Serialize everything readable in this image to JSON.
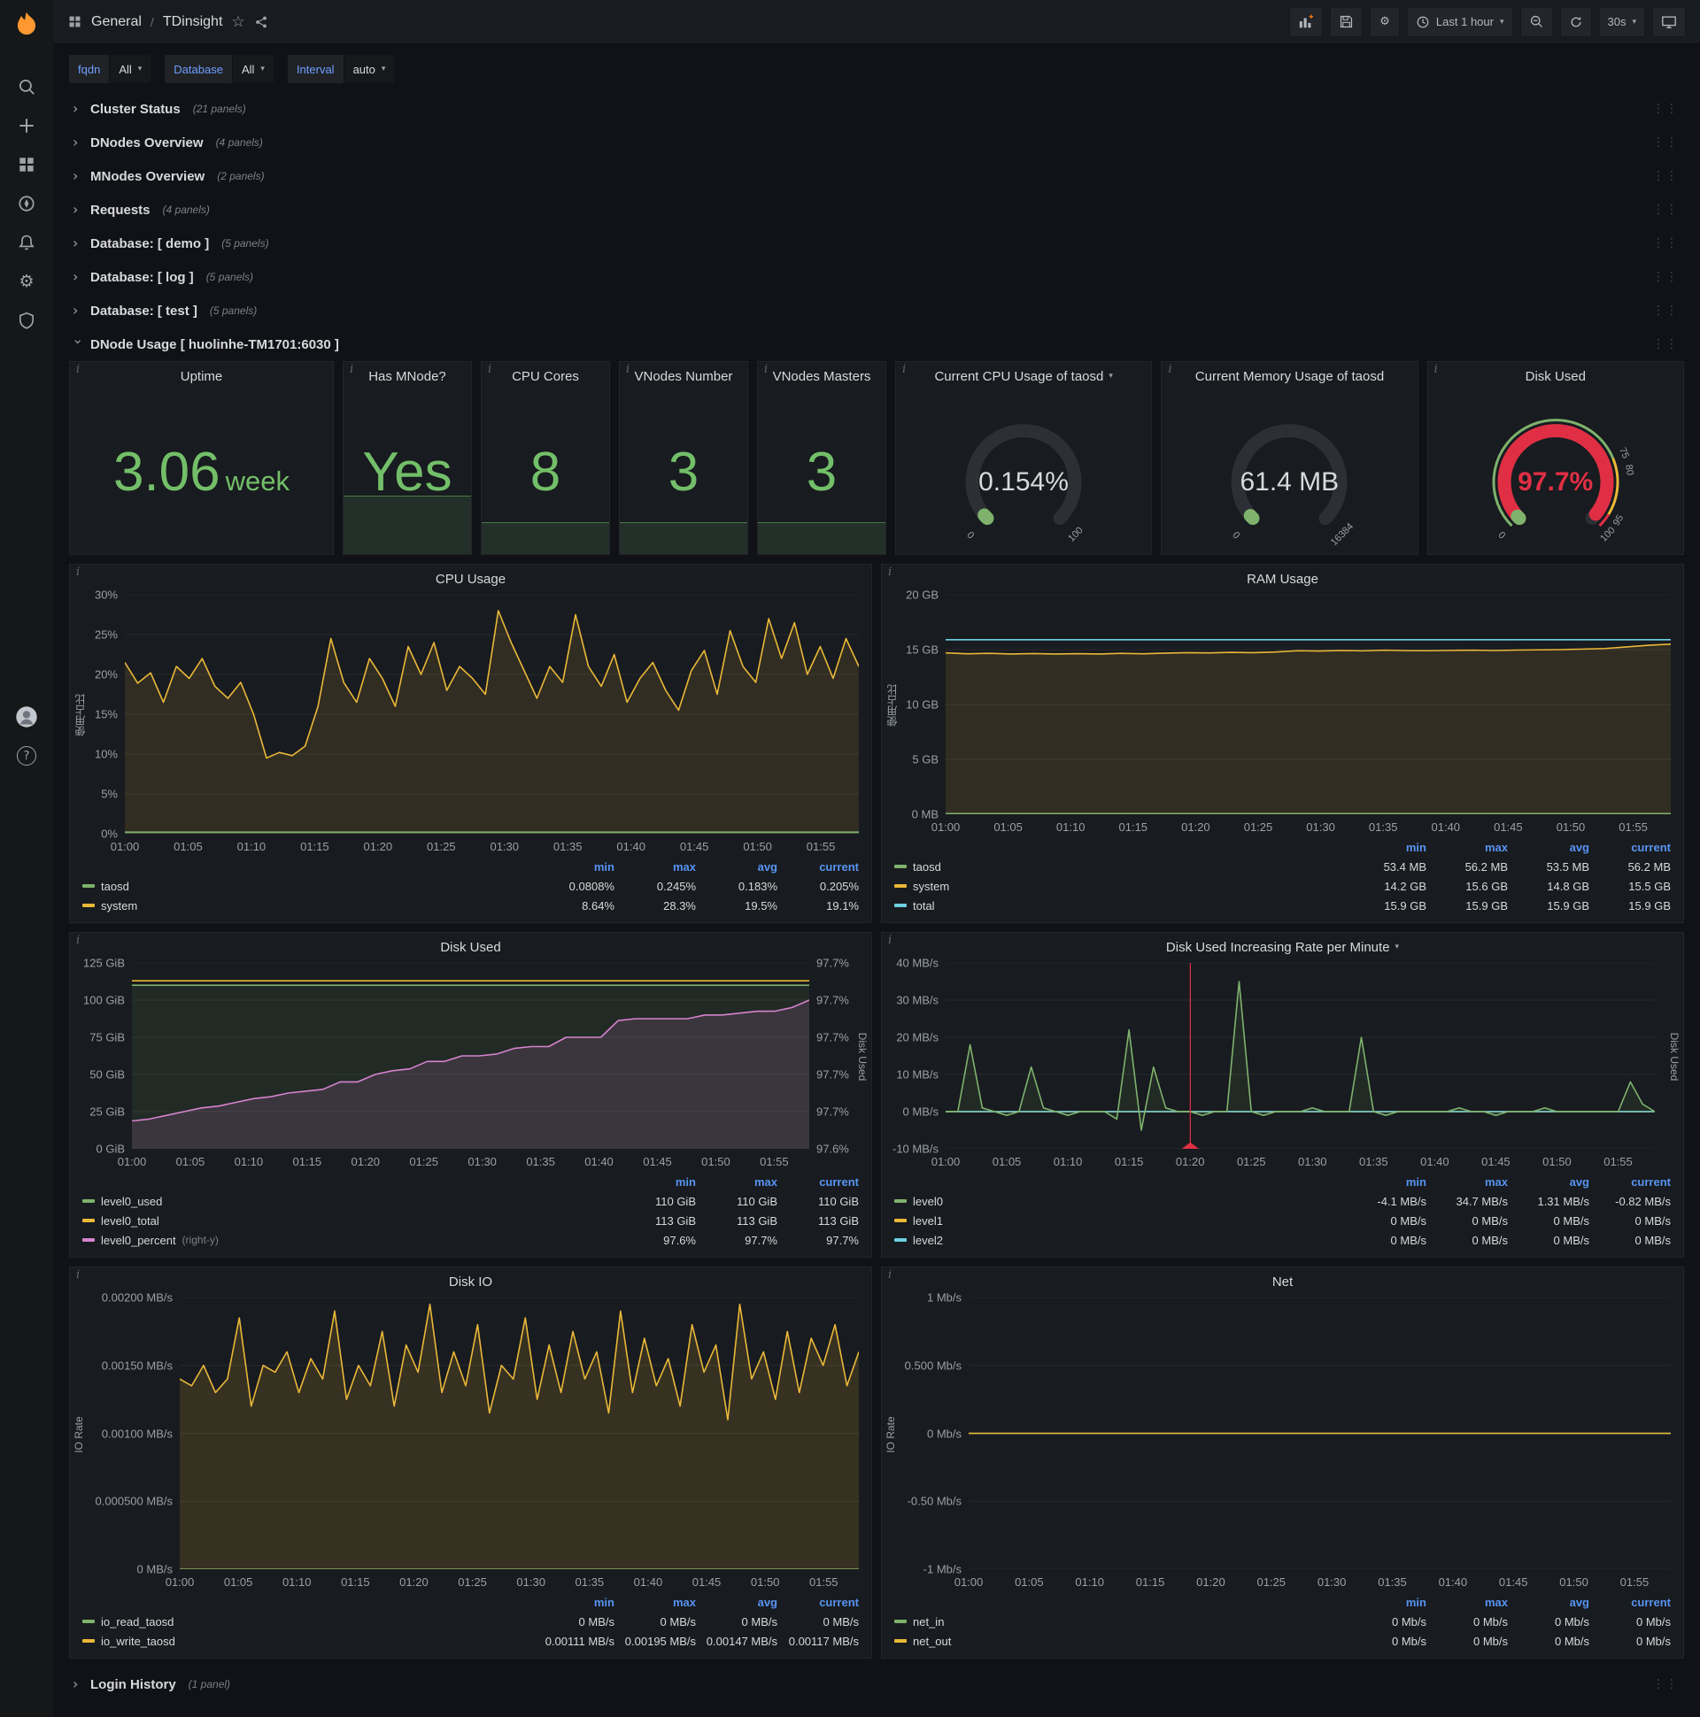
{
  "ui": {
    "info_glyph": "i",
    "caret": "▾",
    "chevron": "›",
    "drag_dots": "⋮⋮",
    "help_glyph": "?"
  },
  "topnav": {
    "breadcrumb": {
      "section": "General",
      "sep": "/",
      "page": "TDinsight"
    },
    "time_range": "Last 1 hour",
    "refresh": "30s"
  },
  "variables": [
    {
      "label": "fqdn",
      "value": "All"
    },
    {
      "label": "Database",
      "value": "All"
    },
    {
      "label": "Interval",
      "value": "auto"
    }
  ],
  "rows": [
    {
      "title": "Cluster Status",
      "count": "(21 panels)"
    },
    {
      "title": "DNodes Overview",
      "count": "(4 panels)"
    },
    {
      "title": "MNodes Overview",
      "count": "(2 panels)"
    },
    {
      "title": "Requests",
      "count": "(4 panels)"
    },
    {
      "title": "Database: [ demo ]",
      "count": "(5 panels)"
    },
    {
      "title": "Database: [ log ]",
      "count": "(5 panels)"
    },
    {
      "title": "Database: [ test ]",
      "count": "(5 panels)"
    }
  ],
  "expanded_row": {
    "title": "DNode Usage [ huolinhe-TM1701:6030 ]"
  },
  "bottom_row": {
    "title": "Login History",
    "count": "(1 panel)"
  },
  "stats": [
    {
      "title": "Uptime",
      "value": "3.06",
      "unit": "week"
    },
    {
      "title": "Has MNode?",
      "value": "Yes"
    },
    {
      "title": "CPU Cores",
      "value": "8"
    },
    {
      "title": "VNodes Number",
      "value": "3"
    },
    {
      "title": "VNodes Masters",
      "value": "3"
    }
  ],
  "gauges": [
    {
      "title": "Current CPU Usage of taosd",
      "has_dropdown": true,
      "value": "0.154%",
      "fraction": 0.018,
      "bar_color": "#7eb26d",
      "value_color": "#d8d9da",
      "ticks": [
        {
          "v": 0,
          "label": "0"
        },
        {
          "v": 100,
          "label": "100"
        }
      ]
    },
    {
      "title": "Current Memory Usage of taosd",
      "value": "61.4 MB",
      "fraction": 0.015,
      "bar_color": "#7eb26d",
      "value_color": "#d8d9da",
      "ticks": [
        {
          "v": 0,
          "label": "0"
        },
        {
          "v": 100,
          "label": "16384"
        }
      ]
    },
    {
      "title": "Disk Used",
      "value": "97.7%",
      "fraction": 0.977,
      "bar_color": "#e02f44",
      "value_color": "#e02f44",
      "start_cap": "#7eb26d",
      "ring": [
        {
          "to": 0.75,
          "color": "#7eb26d"
        },
        {
          "to": 0.95,
          "color": "#eab839"
        },
        {
          "to": 1,
          "color": "#e02f44"
        }
      ],
      "ticks": [
        {
          "v": 0,
          "label": "0"
        },
        {
          "v": 75,
          "label": "75"
        },
        {
          "v": 80,
          "label": "80"
        },
        {
          "v": 95,
          "label": "95"
        },
        {
          "v": 100,
          "label": "100"
        }
      ]
    }
  ],
  "time_axis": {
    "ticks": [
      "01:00",
      "01:05",
      "01:10",
      "01:15",
      "01:20",
      "01:25",
      "01:30",
      "01:35",
      "01:40",
      "01:45",
      "01:50",
      "01:55"
    ],
    "step_frac": 0.0862
  },
  "chart_data": [
    {
      "id": "cpu-usage",
      "type": "line",
      "title": "CPU Usage",
      "ylabel": "使用占比",
      "ylim": [
        0,
        30
      ],
      "ytick_w": 44,
      "yticks": [
        "30%",
        "25%",
        "20%",
        "15%",
        "10%",
        "5%",
        "0%"
      ],
      "series": [
        {
          "name": "system",
          "color": "#eab839",
          "fill": 0.12,
          "values": [
            21.5,
            18.9,
            20.2,
            16.5,
            21,
            19.5,
            22,
            18.5,
            17,
            19,
            15,
            9.5,
            10.2,
            9.8,
            11,
            16,
            24.5,
            19,
            16.5,
            22,
            19.5,
            16,
            23.5,
            20,
            24,
            18,
            21,
            19.5,
            17.5,
            28,
            24,
            20.5,
            17,
            21,
            19,
            27.5,
            21,
            18.5,
            22.5,
            16.5,
            19.5,
            21.5,
            18,
            15.5,
            20.5,
            23,
            17.5,
            25.5,
            21,
            19,
            27,
            22,
            26.5,
            20,
            23.5,
            19.5,
            24.5,
            21
          ]
        },
        {
          "name": "taosd",
          "color": "#7eb26d",
          "fill": 0.25,
          "value": 0.2
        }
      ],
      "legend": {
        "columns": [
          "min",
          "max",
          "avg",
          "current"
        ],
        "rows": [
          {
            "name": "taosd",
            "color": "#7eb26d",
            "values": [
              "0.0808%",
              "0.245%",
              "0.183%",
              "0.205%"
            ]
          },
          {
            "name": "system",
            "color": "#eab839",
            "values": [
              "8.64%",
              "28.3%",
              "19.5%",
              "19.1%"
            ]
          }
        ]
      }
    },
    {
      "id": "ram-usage",
      "type": "line",
      "title": "RAM Usage",
      "ylabel": "使用占比",
      "ylim": [
        0,
        20
      ],
      "ytick_w": 54,
      "yticks": [
        "20 GB",
        "15 GB",
        "10 GB",
        "5 GB",
        "0 MB"
      ],
      "series": [
        {
          "name": "system",
          "color": "#eab839",
          "fill": 0.12,
          "values": [
            14.7,
            14.62,
            14.66,
            14.6,
            14.64,
            14.6,
            14.63,
            14.6,
            14.66,
            14.62,
            14.68,
            14.72,
            14.7,
            14.75,
            14.72,
            14.78,
            14.9,
            14.87,
            14.92,
            14.89,
            14.95,
            14.91,
            14.9,
            14.93,
            14.95,
            14.92,
            14.96,
            14.98,
            15,
            15.05,
            15.1,
            15.25,
            15.4,
            15.5
          ]
        },
        {
          "name": "taosd",
          "color": "#7eb26d",
          "value": 0.055
        },
        {
          "name": "total",
          "color": "#6ed0e0",
          "value": 15.9
        }
      ],
      "legend": {
        "columns": [
          "min",
          "max",
          "avg",
          "current"
        ],
        "rows": [
          {
            "name": "taosd",
            "color": "#7eb26d",
            "values": [
              "53.4 MB",
              "56.2 MB",
              "53.5 MB",
              "56.2 MB"
            ]
          },
          {
            "name": "system",
            "color": "#eab839",
            "values": [
              "14.2 GB",
              "15.6 GB",
              "14.8 GB",
              "15.5 GB"
            ]
          },
          {
            "name": "total",
            "color": "#6ed0e0",
            "values": [
              "15.9 GB",
              "15.9 GB",
              "15.9 GB",
              "15.9 GB"
            ]
          }
        ]
      }
    },
    {
      "id": "disk-used",
      "type": "line",
      "title": "Disk Used",
      "ylim": [
        0,
        125
      ],
      "ytick_w": 64,
      "yticks": [
        "125 GiB",
        "100 GiB",
        "75 GiB",
        "50 GiB",
        "25 GiB",
        "0 GiB"
      ],
      "ylim_right": [
        97.64,
        97.74
      ],
      "ytick_right_w": 52,
      "yticks_right": [
        "97.7%",
        "97.7%",
        "97.7%",
        "97.7%",
        "97.7%",
        "97.6%"
      ],
      "ylabel_right": "Disk Used",
      "series": [
        {
          "name": "level0_used",
          "color": "#7eb26d",
          "fill": 0.1,
          "value": 110
        },
        {
          "name": "level0_percent",
          "color": "#d683ce",
          "axis": "right",
          "fill": 0.14,
          "values": [
            97.655,
            97.656,
            97.658,
            97.66,
            97.662,
            97.663,
            97.665,
            97.667,
            97.668,
            97.67,
            97.671,
            97.672,
            97.676,
            97.676,
            97.68,
            97.682,
            97.683,
            97.687,
            97.687,
            97.69,
            97.69,
            97.691,
            97.694,
            97.695,
            97.695,
            97.7,
            97.7,
            97.7,
            97.709,
            97.71,
            97.71,
            97.71,
            97.71,
            97.712,
            97.712,
            97.713,
            97.714,
            97.714,
            97.716,
            97.72
          ]
        },
        {
          "name": "level0_total",
          "color": "#eab839",
          "value": 113
        }
      ],
      "legend": {
        "columns": [
          "min",
          "max",
          "current"
        ],
        "rows": [
          {
            "name": "level0_used",
            "color": "#7eb26d",
            "values": [
              "110 GiB",
              "110 GiB",
              "110 GiB"
            ]
          },
          {
            "name": "level0_total",
            "color": "#eab839",
            "values": [
              "113 GiB",
              "113 GiB",
              "113 GiB"
            ]
          },
          {
            "name": "level0_percent",
            "suffix": "(right-y)",
            "color": "#d683ce",
            "values": [
              "97.6%",
              "97.7%",
              "97.7%"
            ]
          }
        ]
      }
    },
    {
      "id": "disk-rate",
      "type": "line",
      "title": "Disk Used Increasing Rate per Minute",
      "has_dropdown": true,
      "ylim": [
        -10,
        40
      ],
      "ytick_w": 66,
      "yticks": [
        "40 MB/s",
        "30 MB/s",
        "20 MB/s",
        "10 MB/s",
        "0 MB/s",
        "-10 MB/s"
      ],
      "ylabel_right": "Disk Used",
      "annotation_x": 0.345,
      "series": [
        {
          "name": "level1",
          "color": "#eab839",
          "value": 0
        },
        {
          "name": "level2",
          "color": "#6ed0e0",
          "value": 0
        },
        {
          "name": "level0",
          "color": "#7eb26d",
          "fill": 0.1,
          "values": [
            0,
            0,
            18,
            1,
            0,
            -1,
            0,
            12,
            1,
            0,
            -1,
            0,
            0,
            0,
            -2,
            22,
            -5,
            12,
            1,
            0,
            0,
            -1,
            0,
            0,
            35,
            0,
            -1,
            0,
            0,
            0,
            1,
            0,
            0,
            0,
            20,
            0,
            -1,
            0,
            0,
            0,
            0,
            0,
            1,
            0,
            0,
            -1,
            0,
            0,
            0,
            1,
            0,
            0,
            0,
            0,
            0,
            0,
            8,
            2,
            0
          ]
        }
      ],
      "legend": {
        "columns": [
          "min",
          "max",
          "avg",
          "current"
        ],
        "rows": [
          {
            "name": "level0",
            "color": "#7eb26d",
            "values": [
              "-4.1 MB/s",
              "34.7 MB/s",
              "1.31 MB/s",
              "-0.82 MB/s"
            ]
          },
          {
            "name": "level1",
            "color": "#eab839",
            "values": [
              "0 MB/s",
              "0 MB/s",
              "0 MB/s",
              "0 MB/s"
            ]
          },
          {
            "name": "level2",
            "color": "#6ed0e0",
            "values": [
              "0 MB/s",
              "0 MB/s",
              "0 MB/s",
              "0 MB/s"
            ]
          }
        ]
      }
    },
    {
      "id": "disk-io",
      "type": "line",
      "title": "Disk IO",
      "ylabel": "IO Rate",
      "ylim": [
        0,
        0.002
      ],
      "ytick_w": 106,
      "yticks": [
        "0.00200 MB/s",
        "0.00150 MB/s",
        "0.00100 MB/s",
        "0.000500 MB/s",
        "0 MB/s"
      ],
      "series": [
        {
          "name": "io_read_taosd",
          "color": "#7eb26d",
          "value": 0
        },
        {
          "name": "io_write_taosd",
          "color": "#eab839",
          "fill": 0.15,
          "values": [
            0.0014,
            0.00135,
            0.0015,
            0.0013,
            0.0014,
            0.00185,
            0.0012,
            0.0015,
            0.00145,
            0.0016,
            0.0013,
            0.00155,
            0.0014,
            0.0019,
            0.00125,
            0.0015,
            0.00135,
            0.00175,
            0.0012,
            0.00165,
            0.00145,
            0.00195,
            0.0013,
            0.0016,
            0.00135,
            0.0018,
            0.00115,
            0.0015,
            0.0014,
            0.00185,
            0.00125,
            0.00165,
            0.0013,
            0.00175,
            0.0014,
            0.0016,
            0.00115,
            0.0019,
            0.0013,
            0.0017,
            0.00135,
            0.00155,
            0.0012,
            0.0018,
            0.00145,
            0.00165,
            0.0011,
            0.00195,
            0.0014,
            0.0016,
            0.00125,
            0.00175,
            0.0013,
            0.0017,
            0.0015,
            0.0018,
            0.00135,
            0.0016
          ]
        }
      ],
      "legend": {
        "columns": [
          "min",
          "max",
          "avg",
          "current"
        ],
        "rows": [
          {
            "name": "io_read_taosd",
            "color": "#7eb26d",
            "values": [
              "0 MB/s",
              "0 MB/s",
              "0 MB/s",
              "0 MB/s"
            ]
          },
          {
            "name": "io_write_taosd",
            "color": "#eab839",
            "values": [
              "0.00111 MB/s",
              "0.00195 MB/s",
              "0.00147 MB/s",
              "0.00117 MB/s"
            ]
          }
        ]
      }
    },
    {
      "id": "net",
      "type": "line",
      "title": "Net",
      "ylabel": "IO Rate",
      "ylim": [
        -1,
        1
      ],
      "ytick_w": 80,
      "yticks": [
        "1 Mb/s",
        "0.500 Mb/s",
        "0 Mb/s",
        "-0.50 Mb/s",
        "-1 Mb/s"
      ],
      "series": [
        {
          "name": "net_in",
          "color": "#7eb26d",
          "value": 0
        },
        {
          "name": "net_out",
          "color": "#eab839",
          "value": 0
        }
      ],
      "legend": {
        "columns": [
          "min",
          "max",
          "avg",
          "current"
        ],
        "rows": [
          {
            "name": "net_in",
            "color": "#7eb26d",
            "values": [
              "0 Mb/s",
              "0 Mb/s",
              "0 Mb/s",
              "0 Mb/s"
            ]
          },
          {
            "name": "net_out",
            "color": "#eab839",
            "values": [
              "0 Mb/s",
              "0 Mb/s",
              "0 Mb/s",
              "0 Mb/s"
            ]
          }
        ]
      }
    }
  ]
}
